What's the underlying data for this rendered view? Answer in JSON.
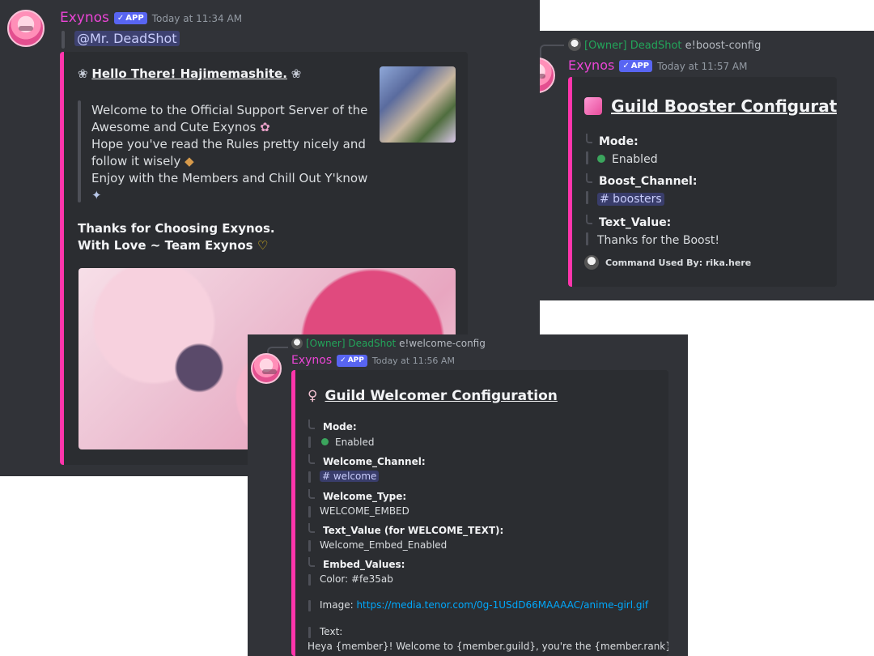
{
  "colors": {
    "accent": "#fe35ab",
    "bot_name": "#eb45d6",
    "owner": "#23a55a",
    "online": "#3ba55d",
    "link": "#00a8fc"
  },
  "badge": {
    "label": "APP",
    "icon": "check-icon"
  },
  "msg1": {
    "username": "Exynos",
    "timestamp": "Today at 11:34 AM",
    "mention": "@Mr. DeadShot",
    "title": "Hello There! Hajimemashite.",
    "lines": [
      "Welcome to the Official Support Server of the",
      "Awesome and Cute Exynos",
      "Hope you've read the Rules pretty nicely and",
      "follow it wisely",
      "Enjoy with the Members and Chill Out Y'know"
    ],
    "thanks_1": "Thanks for Choosing Exynos.",
    "thanks_2": "With Love ~ Team Exynos"
  },
  "msg2": {
    "reply_owner": "[Owner] DeadShot",
    "reply_cmd": "e!boost-config",
    "username": "Exynos",
    "timestamp": "Today at 11:57 AM",
    "title": "Guild Booster Configuration",
    "mode_label": "Mode:",
    "mode_value": "Enabled",
    "channel_label": "Boost_Channel:",
    "channel_value": "# boosters",
    "text_label": "Text_Value:",
    "text_value": "Thanks for the Boost!",
    "footer": "Command Used By: rika.here"
  },
  "msg3": {
    "reply_owner": "[Owner] DeadShot",
    "reply_cmd": "e!welcome-config",
    "username": "Exynos",
    "timestamp": "Today at 11:56 AM",
    "title": "Guild Welcomer Configuration",
    "mode_label": "Mode:",
    "mode_value": "Enabled",
    "channel_label": "Welcome_Channel:",
    "channel_value": "# welcome",
    "type_label": "Welcome_Type:",
    "type_value": "WELCOME_EMBED",
    "text_label": "Text_Value (for WELCOME_TEXT):",
    "text_value": "Welcome_Embed_Enabled",
    "embed_label": "Embed_Values:",
    "color_line": "Color: #fe35ab",
    "image_label": "Image:",
    "image_url": "https://media.tenor.com/0g-1USdD66MAAAAC/anime-girl.gif",
    "text_line_label": "Text:",
    "text_line": "Heya {member}! Welcome to {member.guild}, you're the {member.rank}th person!"
  }
}
